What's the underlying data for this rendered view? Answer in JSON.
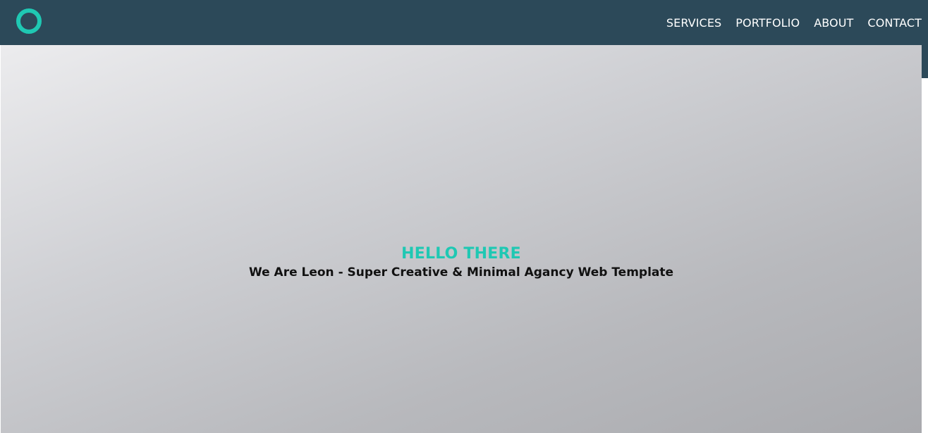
{
  "header": {
    "logo_icon": "ring-logo-icon",
    "nav": [
      {
        "label": "SERVICES"
      },
      {
        "label": "PORTFOLIO"
      },
      {
        "label": "ABOUT"
      },
      {
        "label": "CONTACT"
      }
    ]
  },
  "hero": {
    "title": "HELLO THERE",
    "subtitle": "We Are Leon - Super Creative & Minimal Agancy Web Template"
  },
  "colors": {
    "navbar": "#2c4959",
    "accent": "#1fc8b3",
    "subtitle": "#111111"
  }
}
